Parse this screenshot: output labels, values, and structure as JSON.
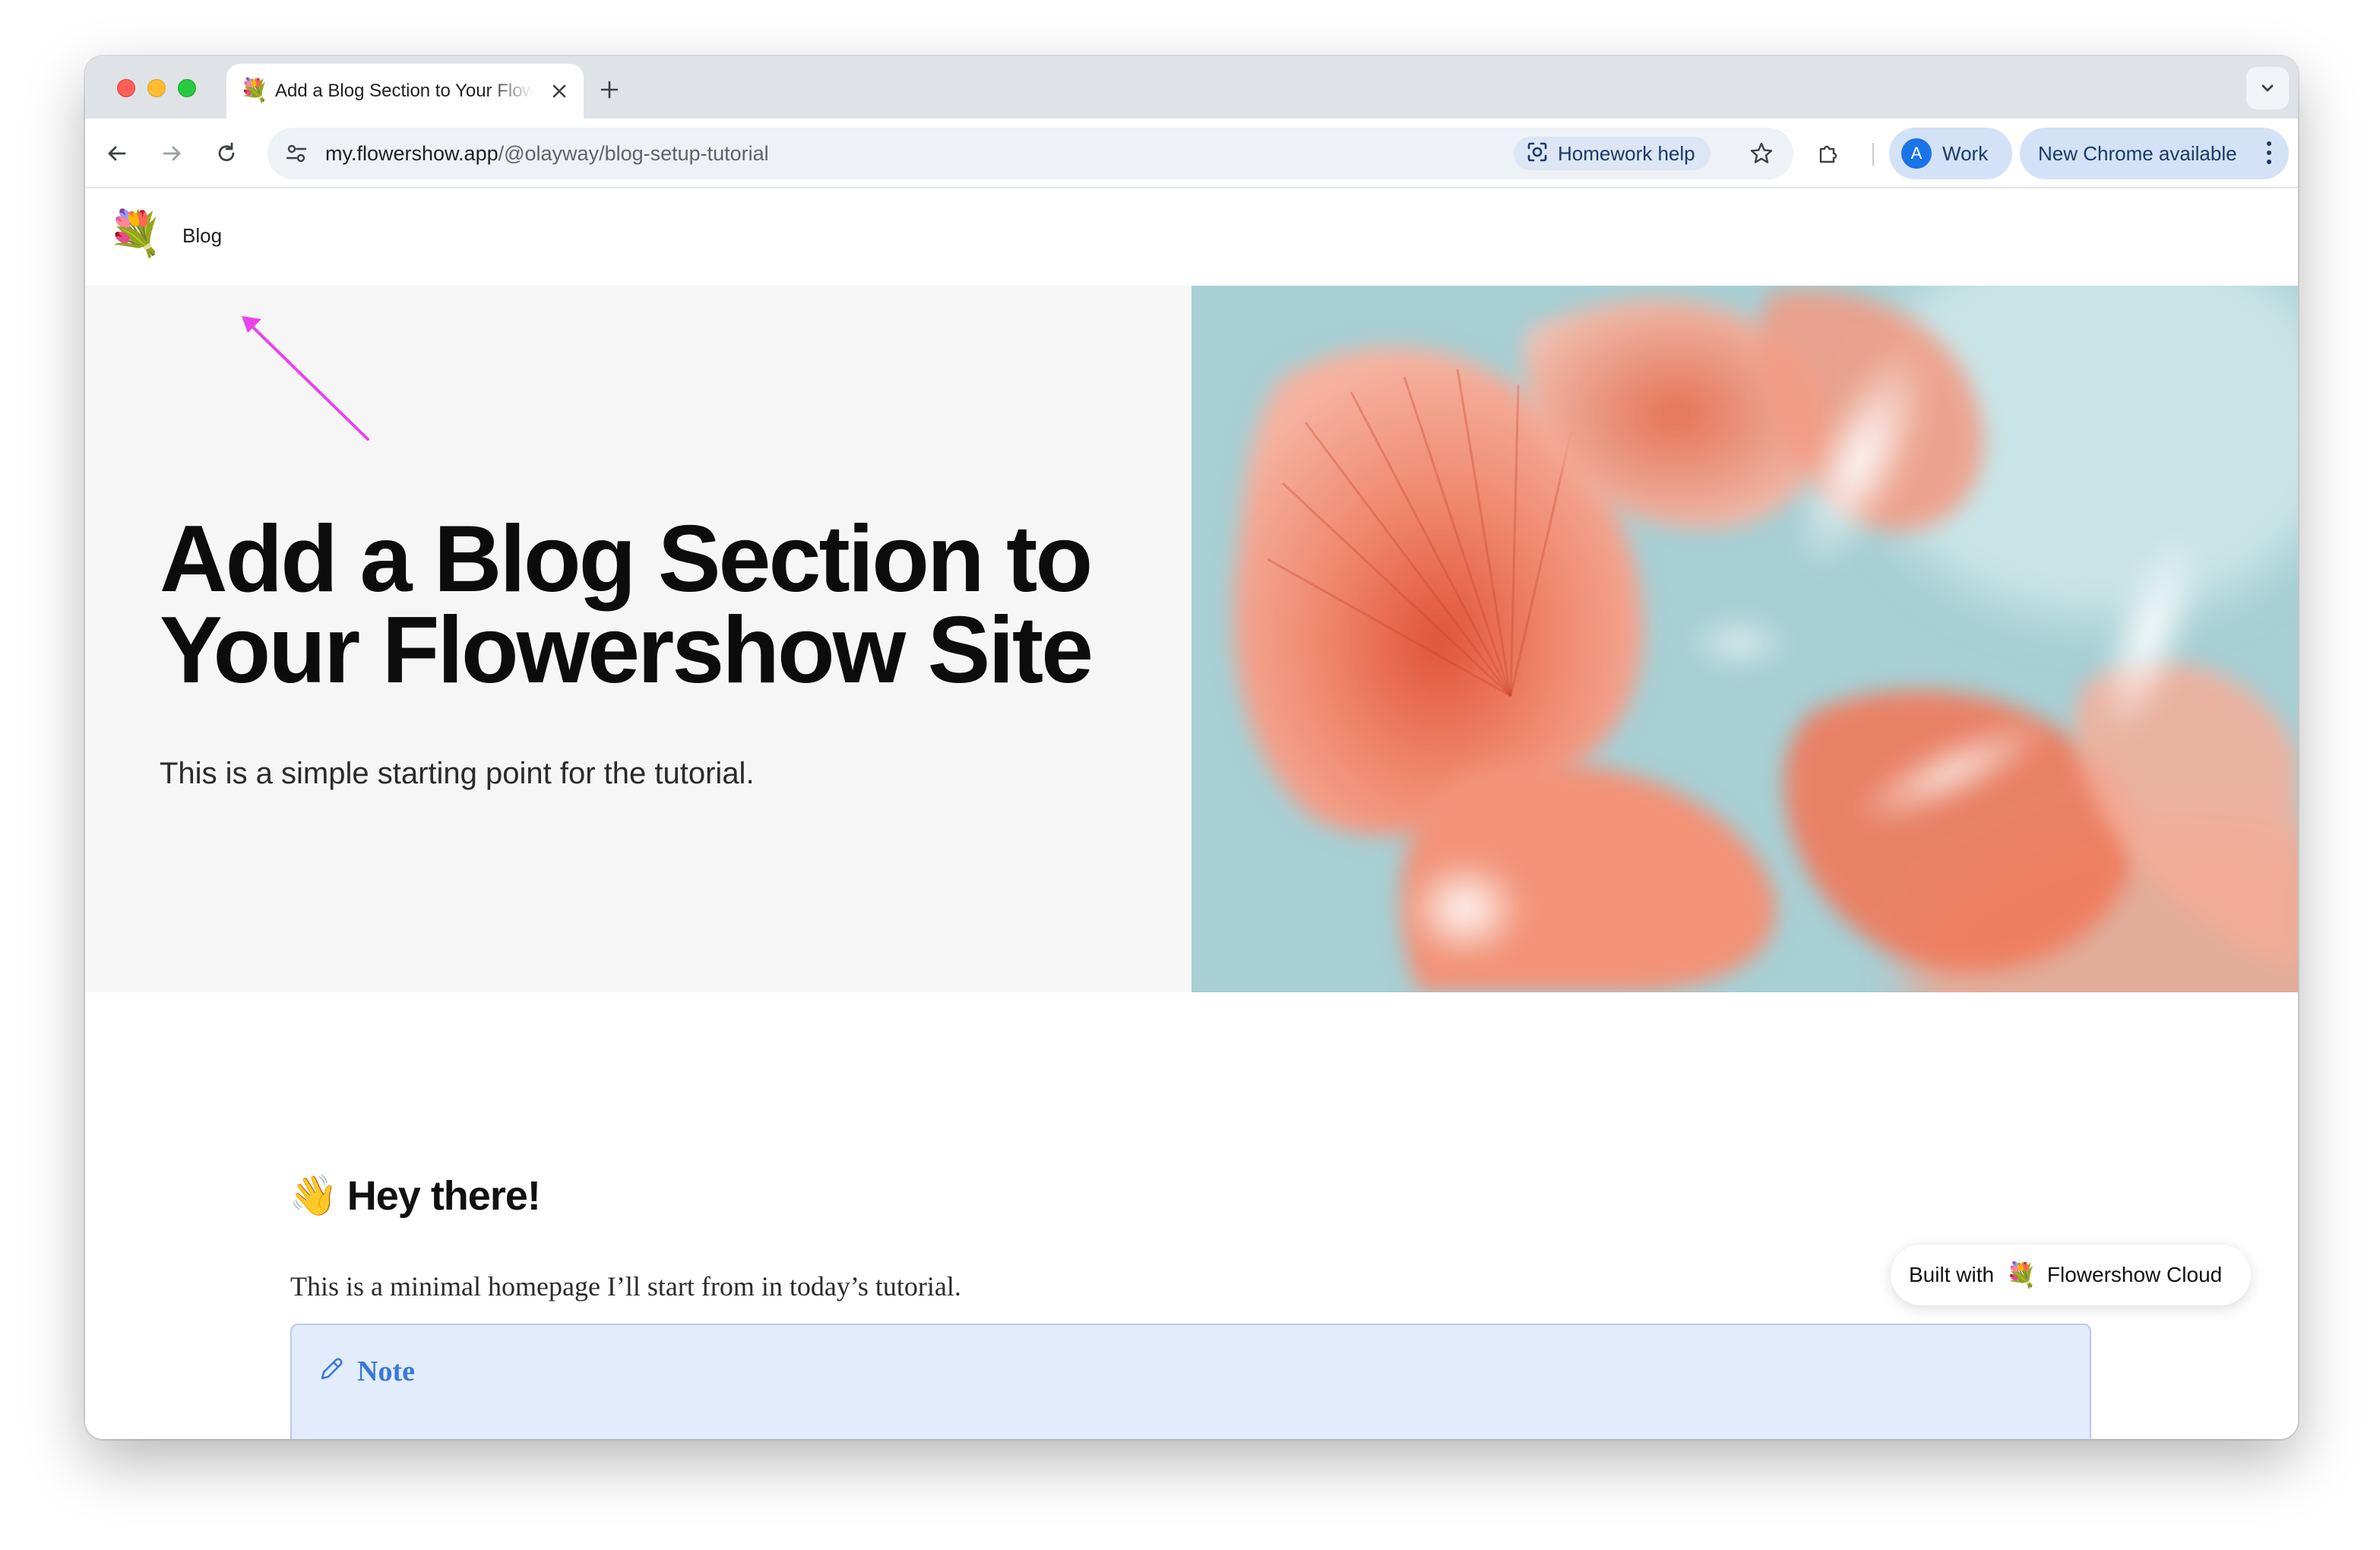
{
  "browser": {
    "tab": {
      "favicon": "💐",
      "title": "Add a Blog Section to Your Flowershow Site",
      "close_icon": "close-icon"
    },
    "new_tab_icon": "plus-icon",
    "tab_search_icon": "chevron-down-icon",
    "address_bar": {
      "url_host": "my.flowershow.app",
      "url_path": "/@olayway/blog-setup-tutorial",
      "site_info_icon": "tune-icon"
    },
    "homework_help": {
      "label": "Homework help",
      "icon": "lens-icon"
    },
    "bookmark_icon": "star-icon",
    "extensions_icon": "puzzle-icon",
    "profile": {
      "avatar_letter": "A",
      "label": "Work"
    },
    "update_button": {
      "label": "New Chrome available"
    }
  },
  "site": {
    "nav": {
      "logo": "💐",
      "blog_link": "Blog"
    },
    "hero": {
      "title": "Add a Blog Section to Your Flowershow Site",
      "subtitle": "This is a simple starting point for the tutorial."
    },
    "content": {
      "heading_emoji": "👋",
      "heading": "Hey there!",
      "paragraph": "This is a minimal homepage I’ll start from in today’s tutorial.",
      "callout": {
        "icon": "pencil-icon",
        "label": "Note"
      }
    },
    "badge": {
      "built_with": "Built with",
      "logo": "💐",
      "name": "Flowershow Cloud"
    }
  },
  "colors": {
    "annotation_arrow": "#e843e8",
    "callout_background": "#e2ecfc",
    "callout_accent": "#3a78d6",
    "hero_left_background": "#f6f6f6"
  }
}
